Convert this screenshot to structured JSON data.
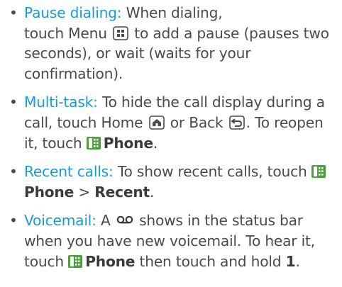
{
  "bullet": "•",
  "items": [
    {
      "term": "Pause dialing:",
      "t1": "When dialing,",
      "t2": "touch Menu",
      "t3": "to add a pause (pauses two seconds), or wait (waits for your confirmation)."
    },
    {
      "term": "Multi-task:",
      "t1": "To hide the call display during a call, touch Home",
      "t2": "or Back",
      "t3": ". To reopen it, touch",
      "b1": "Phone",
      "t4": "."
    },
    {
      "term": "Recent calls:",
      "t1": "To show recent calls, touch",
      "b1": "Phone",
      "t2": ">",
      "b2": "Recent",
      "t3": "."
    },
    {
      "term": "Voicemail:",
      "t1": "A",
      "t2": "shows in the status bar when you have new voicemail. To hear it, touch",
      "b1": "Phone",
      "t3": "then touch and hold",
      "b2": "1",
      "t4": "."
    }
  ],
  "icons": {
    "menu_key": "menu-key-icon",
    "home_key": "home-key-icon",
    "back_key": "back-key-icon",
    "phone_app": "phone-app-icon",
    "voicemail": "voicemail-icon"
  },
  "colors": {
    "term": "#1a9bd6",
    "text": "#4a4a4a",
    "phone_icon": "#4aa23a"
  }
}
